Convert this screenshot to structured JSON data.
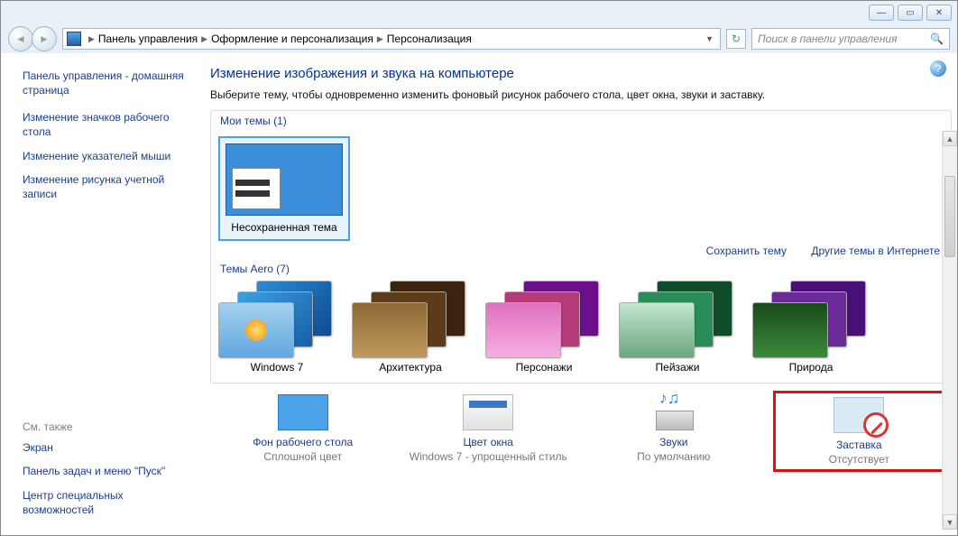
{
  "breadcrumb": {
    "items": [
      "Панель управления",
      "Оформление и персонализация",
      "Персонализация"
    ]
  },
  "search": {
    "placeholder": "Поиск в панели управления"
  },
  "sidebar": {
    "home": "Панель управления - домашняя страница",
    "tasks": [
      "Изменение значков рабочего стола",
      "Изменение указателей мыши",
      "Изменение рисунка учетной записи"
    ],
    "see_also_label": "См. также",
    "see_also": [
      "Экран",
      "Панель задач и меню \"Пуск\"",
      "Центр специальных возможностей"
    ]
  },
  "main": {
    "title": "Изменение изображения и звука на компьютере",
    "subtitle": "Выберите тему, чтобы одновременно изменить фоновый рисунок рабочего стола, цвет окна, звуки и заставку.",
    "my_themes_label": "Мои темы (1)",
    "my_theme_name": "Несохраненная тема",
    "save_theme": "Сохранить тему",
    "more_themes": "Другие темы в Интернете",
    "aero_label": "Темы Aero (7)",
    "aero": [
      "Windows 7",
      "Архитектура",
      "Персонажи",
      "Пейзажи",
      "Природа"
    ],
    "bottom": {
      "bg": {
        "title": "Фон рабочего стола",
        "value": "Сплошной цвет"
      },
      "wc": {
        "title": "Цвет окна",
        "value": "Windows 7 - упрощенный стиль"
      },
      "snd": {
        "title": "Звуки",
        "value": "По умолчанию"
      },
      "ss": {
        "title": "Заставка",
        "value": "Отсутствует"
      }
    }
  }
}
